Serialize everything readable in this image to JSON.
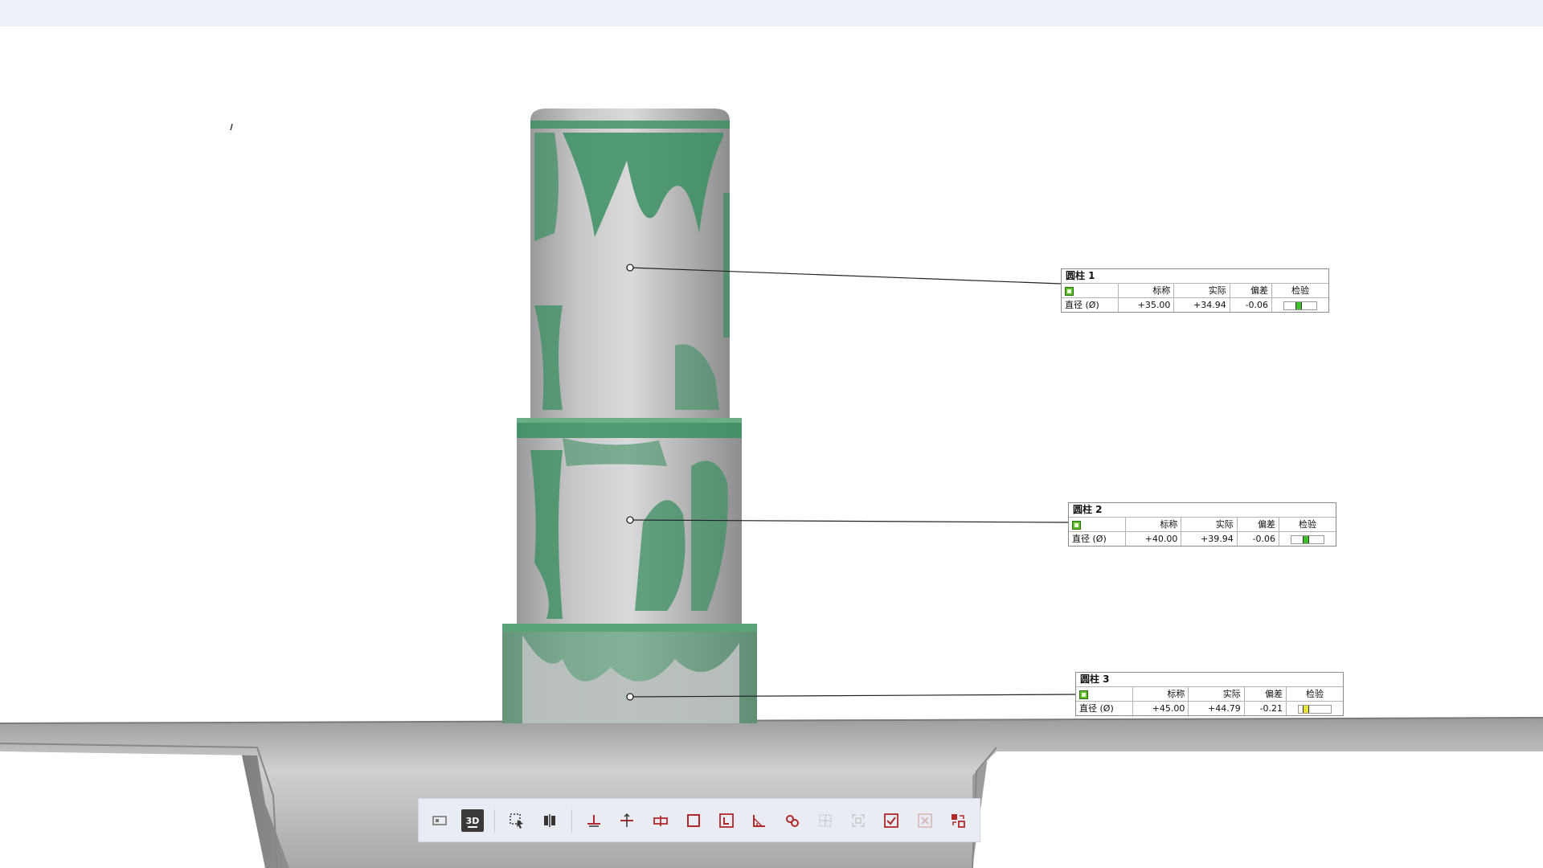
{
  "callouts": [
    {
      "title": "圆柱 1",
      "headers": [
        "标称",
        "实际",
        "偏差",
        "检验"
      ],
      "row_label": "直径 (Ø)",
      "nominal": "+35.00",
      "actual": "+34.94",
      "deviation": "-0.06",
      "status_color": "#3fbf2a",
      "gauge_level": 0.45
    },
    {
      "title": "圆柱 2",
      "headers": [
        "标称",
        "实际",
        "偏差",
        "检验"
      ],
      "row_label": "直径 (Ø)",
      "nominal": "+40.00",
      "actual": "+39.94",
      "deviation": "-0.06",
      "status_color": "#3fbf2a",
      "gauge_level": 0.45
    },
    {
      "title": "圆柱 3",
      "headers": [
        "标称",
        "实际",
        "偏差",
        "检验"
      ],
      "row_label": "直径 (Ø)",
      "nominal": "+45.00",
      "actual": "+44.79",
      "deviation": "-0.21",
      "status_color": "#e8e23a",
      "gauge_level": 0.15
    }
  ],
  "toolbar": {
    "buttons": [
      {
        "icon": "view-2d-icon",
        "state": "normal"
      },
      {
        "icon": "view-3d-icon",
        "label": "3D",
        "state": "active"
      },
      {
        "icon": "select-region-icon",
        "state": "normal"
      },
      {
        "icon": "compare-icon",
        "state": "normal"
      },
      {
        "icon": "plane-align-icon",
        "state": "normal"
      },
      {
        "icon": "section-icon",
        "state": "normal"
      },
      {
        "icon": "gap-measure-icon",
        "state": "normal"
      },
      {
        "icon": "rectangle-icon",
        "state": "normal"
      },
      {
        "icon": "dimension-icon",
        "state": "normal"
      },
      {
        "icon": "angle-icon",
        "state": "normal"
      },
      {
        "icon": "link-icon",
        "state": "normal"
      },
      {
        "icon": "grid-select-icon",
        "state": "disabled"
      },
      {
        "icon": "fit-icon",
        "state": "disabled"
      },
      {
        "icon": "checklist-icon",
        "state": "normal"
      },
      {
        "icon": "delete-icon",
        "state": "disabled"
      },
      {
        "icon": "transform-icon",
        "state": "normal"
      }
    ]
  },
  "colors": {
    "mesh_gray": "#b9b9b9",
    "in_tolerance_green": "#3a8f62",
    "icon_red": "#b0282a"
  }
}
